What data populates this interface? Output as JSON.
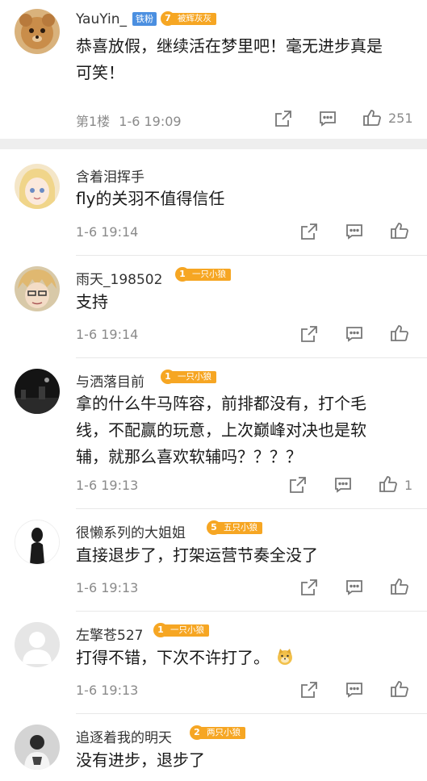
{
  "top_comment": {
    "username": "YauYin_",
    "fan_badge": "铁粉",
    "level": "7",
    "level_title": "被辉灰灰",
    "text_line1": "恭喜放假，继续活在梦里吧！毫无进步真是",
    "text_line2": "可笑！",
    "floor": "第1楼",
    "time": "1-6 19:09",
    "likes": "251"
  },
  "replies": [
    {
      "username": "含着泪挥手",
      "text_lines": [
        "fly的关羽不值得信任"
      ],
      "time": "1-6 19:14",
      "likes": ""
    },
    {
      "username": "雨天_198502",
      "level": "1",
      "level_title": "一只小狼",
      "text_lines": [
        "支持"
      ],
      "time": "1-6 19:14",
      "likes": ""
    },
    {
      "username": "与洒落目前",
      "level": "1",
      "level_title": "一只小狼",
      "text_lines": [
        "拿的什么牛马阵容，前排都没有，打个毛",
        "线，不配赢的玩意，上次巅峰对决也是软",
        "辅，就那么喜欢软辅吗？？？？"
      ],
      "time": "1-6 19:13",
      "likes": "1"
    },
    {
      "username": "很懒系列的大姐姐",
      "level": "5",
      "level_title": "五只小狼",
      "text_lines": [
        "直接退步了，打架运营节奏全没了"
      ],
      "time": "1-6 19:13",
      "likes": ""
    },
    {
      "username": "左擎苍527",
      "level": "1",
      "level_title": "一只小狼",
      "text_lines": [
        "打得不错，下次不许打了。"
      ],
      "emoji": "doge-emoji",
      "time": "1-6 19:13",
      "likes": ""
    },
    {
      "username": "追逐着我的明天",
      "level": "2",
      "level_title": "两只小狼",
      "text_lines": [
        "没有进步，退步了"
      ],
      "time": "",
      "likes": ""
    }
  ],
  "icons": {
    "share": "share-icon",
    "comment": "comment-icon",
    "like": "thumbs-up-icon"
  },
  "colors": {
    "badge_blue": "#4b8fe0",
    "level_orange": "#f6a623",
    "meta_gray": "#8a8a8a"
  }
}
